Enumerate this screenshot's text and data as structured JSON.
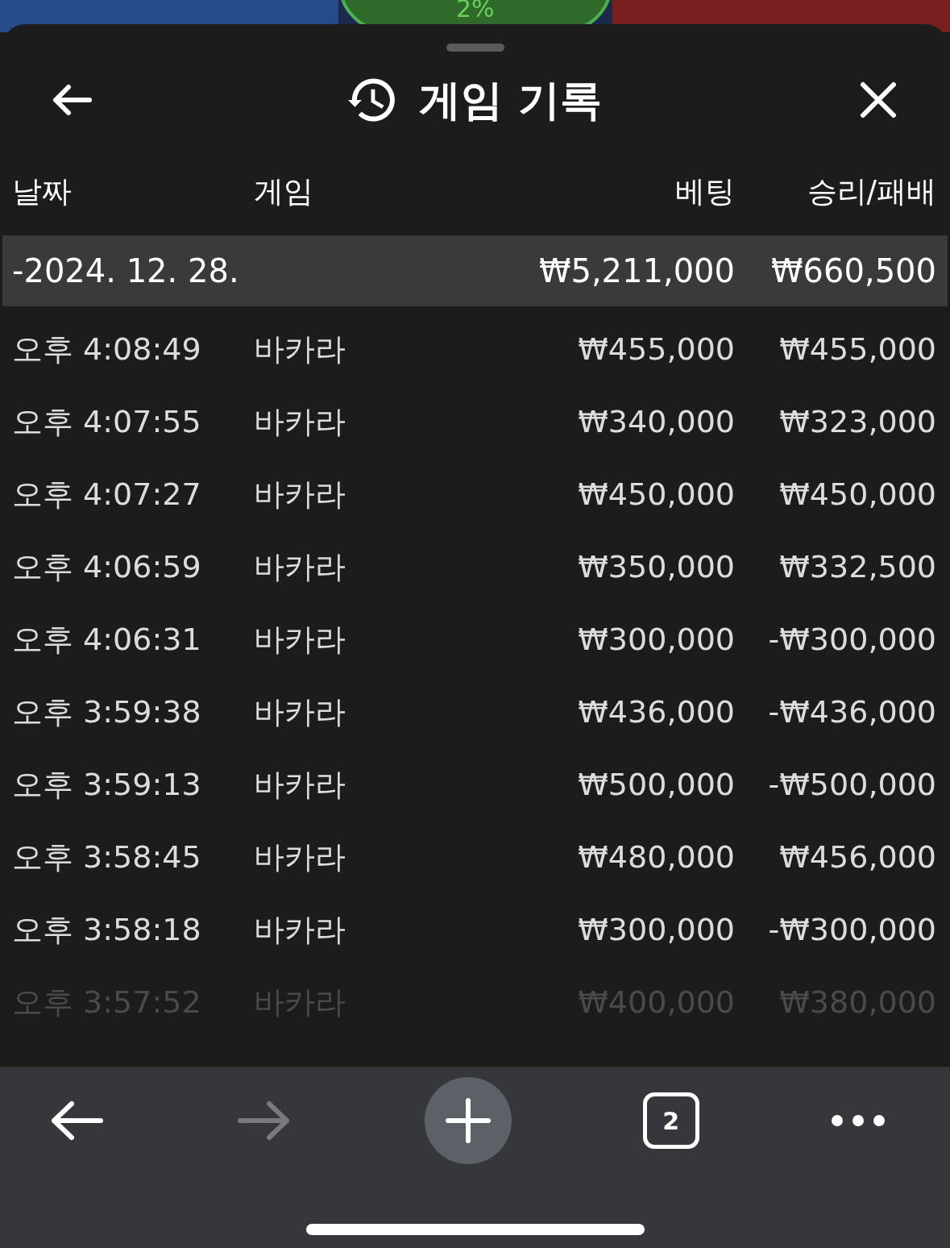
{
  "background_game": {
    "percent": "2%"
  },
  "sheet": {
    "title": "게임 기록"
  },
  "table": {
    "columns": [
      "날짜",
      "게임",
      "베팅",
      "승리/패배"
    ],
    "day_group": {
      "date": "-2024. 12. 28.",
      "bet": "₩5,211,000",
      "result": "₩660,500"
    },
    "rows": [
      {
        "time": "오후 4:08:49",
        "game": "바카라",
        "bet": "₩455,000",
        "result": "₩455,000",
        "faded": false
      },
      {
        "time": "오후 4:07:55",
        "game": "바카라",
        "bet": "₩340,000",
        "result": "₩323,000",
        "faded": false
      },
      {
        "time": "오후 4:07:27",
        "game": "바카라",
        "bet": "₩450,000",
        "result": "₩450,000",
        "faded": false
      },
      {
        "time": "오후 4:06:59",
        "game": "바카라",
        "bet": "₩350,000",
        "result": "₩332,500",
        "faded": false
      },
      {
        "time": "오후 4:06:31",
        "game": "바카라",
        "bet": "₩300,000",
        "result": "-₩300,000",
        "faded": false
      },
      {
        "time": "오후 3:59:38",
        "game": "바카라",
        "bet": "₩436,000",
        "result": "-₩436,000",
        "faded": false
      },
      {
        "time": "오후 3:59:13",
        "game": "바카라",
        "bet": "₩500,000",
        "result": "-₩500,000",
        "faded": false
      },
      {
        "time": "오후 3:58:45",
        "game": "바카라",
        "bet": "₩480,000",
        "result": "₩456,000",
        "faded": false
      },
      {
        "time": "오후 3:58:18",
        "game": "바카라",
        "bet": "₩300,000",
        "result": "-₩300,000",
        "faded": false
      },
      {
        "time": "오후 3:57:52",
        "game": "바카라",
        "bet": "₩400,000",
        "result": "₩380,000",
        "faded": true
      }
    ]
  },
  "browser_toolbar": {
    "forward_disabled": true,
    "tab_count": "2"
  }
}
